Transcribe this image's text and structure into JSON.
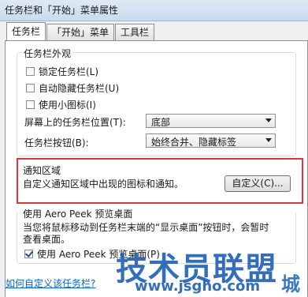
{
  "window": {
    "title": "任务栏和「开始」菜单属性"
  },
  "tabs": [
    {
      "label": "任务栏",
      "active": true
    },
    {
      "label": "「开始」菜单",
      "active": false
    },
    {
      "label": "工具栏",
      "active": false
    }
  ],
  "appearance": {
    "legend": "任务栏外观",
    "lock_taskbar": {
      "label": "锁定任务栏(L)",
      "checked": false
    },
    "auto_hide": {
      "label": "自动隐藏任务栏(U)",
      "checked": false
    },
    "small_icons": {
      "label": "使用小图标(I)",
      "checked": false
    },
    "position_label": "屏幕上的任务栏位置(T):",
    "position_value": "底部",
    "buttons_label": "任务栏按钮(B):",
    "buttons_value": "始终合并、隐藏标签"
  },
  "notification": {
    "legend": "通知区域",
    "description": "自定义通知区域中出现的图标和通知。",
    "customize_button": "自定义(C)..."
  },
  "aero_peek": {
    "legend": "使用 Aero Peek 预览桌面",
    "description_line1": "当您将鼠标移动到任务栏末端的“显示桌面”按钮时，会暂时",
    "description_line2": "查看桌面。",
    "use_peek": {
      "label": "使用 Aero Peek 预览桌面(P)",
      "checked": true
    }
  },
  "help_link": "如何自定义该任务栏?",
  "watermark": {
    "brand": "技术员联盟",
    "url": "www.jsgho.com",
    "suffix": "城"
  },
  "colors": {
    "highlight_border": "#d9363e",
    "link": "#0066cc",
    "watermark_blue": "#1d5fb3"
  }
}
